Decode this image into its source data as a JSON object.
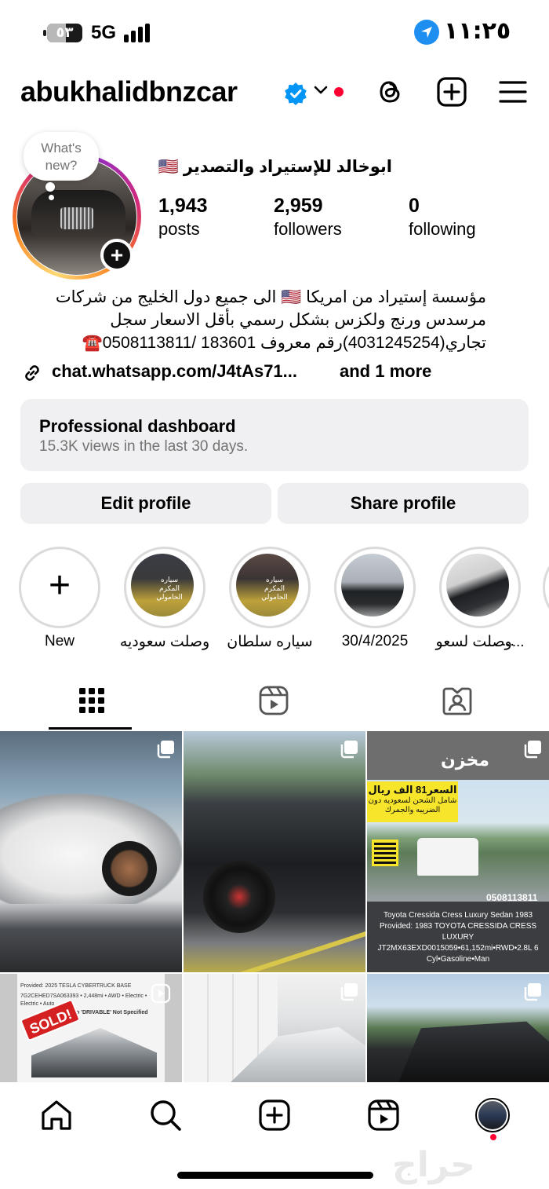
{
  "status_bar": {
    "battery_label": "٥٣",
    "battery_level": 0.53,
    "network": "5G",
    "time": "١١:٢٥"
  },
  "header": {
    "username": "abukhalidbnzcar",
    "icons": [
      "verified-badge-icon",
      "chevron-down-icon",
      "threads-icon",
      "create-post-icon",
      "menu-icon"
    ],
    "colors": {
      "verified": "#0095f6",
      "notification_dot": "#ff0033"
    }
  },
  "profile": {
    "note_placeholder": "What's new?",
    "full_name": "ابوخالد للإستيراد والتصدير 🇺🇸",
    "stats": [
      {
        "value": "1,943",
        "label": "posts"
      },
      {
        "value": "2,959",
        "label": "followers"
      },
      {
        "value": "0",
        "label": "following"
      }
    ],
    "bio_lines": [
      "مؤسسة إستيراد من امريكا 🇺🇸 الى جميع دول الخليج من شركات",
      "مرسدس ورنج ولكزس بشكل رسمي بأقل الاسعار سجل",
      "تجاري(4031245254)رقم معروف 183601 /0508113811☎️"
    ],
    "link": {
      "url": "chat.whatsapp.com/J4tAs71...",
      "more": "and 1 more"
    }
  },
  "dashboard": {
    "title": "Professional dashboard",
    "subtitle": "15.3K views in the last 30 days."
  },
  "buttons": {
    "edit": "Edit profile",
    "share": "Share profile"
  },
  "highlights": [
    {
      "label": "New"
    },
    {
      "label": "وصلت سعوديه",
      "overlay": "سياره المكرم الحامولي"
    },
    {
      "label": "سياره سلطان",
      "overlay": "سياره المكرم الحامولي"
    },
    {
      "label": "30/4/2025"
    },
    {
      "label": "وصلت لسعو..."
    },
    {
      "label": "..."
    }
  ],
  "tabs": [
    "grid-icon",
    "reels-icon",
    "tagged-icon"
  ],
  "posts": {
    "tile3_top": "مخزن",
    "tile3_price": "السعر81 الف ريال",
    "tile3_price_note": "شامل الشحن لسعوديه دون الضريبه والجمرك",
    "tile3_phone": "0508113811",
    "tile3_caption": "Toyota Cressida Cress Luxury Sedan 1983 Provided: 1983 TOYOTA CRESSIDA CRESS LUXURY JT2MX63EXD0015059•61,152mi•RWD•2.8L 6 Cyl•Gasoline•Man",
    "tile4_header": "Provided: 2025 TESLA CYBERTRUCK BASE",
    "tile4_specs": "7G2CEHED7SA063393 • 2,448mi • AWD • Electric • Electric • Auto",
    "tile4_not_drivable": "No 'DRIVABLE' Not Specified",
    "tile4_badge": "SOLD!"
  },
  "bottom_nav": [
    "home-icon",
    "search-icon",
    "create-icon",
    "reels-icon",
    "profile-avatar"
  ],
  "watermark": "حراج"
}
